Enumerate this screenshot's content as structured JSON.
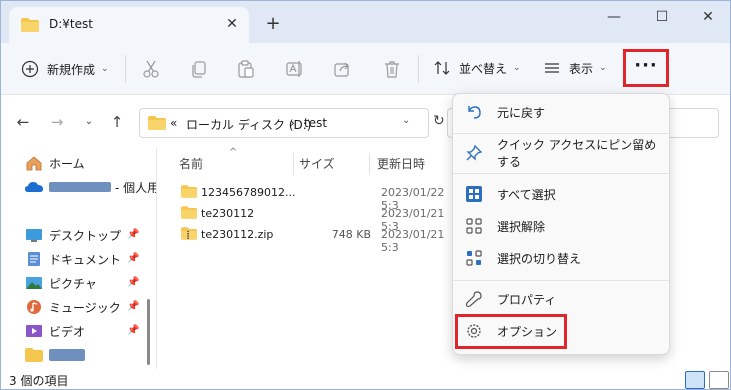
{
  "window": {
    "tab_title": "D:¥test",
    "new_tab": "+",
    "minimize": "—",
    "maximize": "☐",
    "close": "✕"
  },
  "toolbar": {
    "new_label": "新規作成",
    "sort_label": "並べ替え",
    "view_label": "表示",
    "more_label": "···",
    "caret": "⌄"
  },
  "address": {
    "overflow": "«",
    "segments": [
      "ローカル ディスク (D:)",
      "test"
    ],
    "separator": "›"
  },
  "sidebar": {
    "items": [
      {
        "label": "ホーム",
        "icon": "home-icon",
        "pinned": false
      },
      {
        "label": "- 個人用",
        "icon": "onedrive-icon",
        "pinned": false
      },
      {
        "label": "デスクトップ",
        "icon": "desktop-icon",
        "pinned": true
      },
      {
        "label": "ドキュメント",
        "icon": "documents-icon",
        "pinned": true
      },
      {
        "label": "ピクチャ",
        "icon": "pictures-icon",
        "pinned": true
      },
      {
        "label": "ミュージック",
        "icon": "music-icon",
        "pinned": true
      },
      {
        "label": "ビデオ",
        "icon": "videos-icon",
        "pinned": true
      }
    ]
  },
  "file_list": {
    "columns": [
      "名前",
      "サイズ",
      "更新日時"
    ],
    "rows": [
      {
        "name": "123456789012...",
        "size": "",
        "date": "2023/01/22 5:3",
        "type": "folder"
      },
      {
        "name": "te230112",
        "size": "",
        "date": "2023/01/21 5:3",
        "type": "folder"
      },
      {
        "name": "te230112.zip",
        "size": "748 KB",
        "date": "2023/01/21 5:3",
        "type": "zip"
      }
    ]
  },
  "menu": {
    "items": [
      {
        "label": "元に戻す",
        "icon": "undo-icon"
      },
      {
        "label": "クイック アクセスにピン留めする",
        "icon": "pin-icon"
      },
      {
        "label": "すべて選択",
        "icon": "select-all-icon"
      },
      {
        "label": "選択解除",
        "icon": "select-none-icon"
      },
      {
        "label": "選択の切り替え",
        "icon": "invert-selection-icon"
      },
      {
        "label": "プロパティ",
        "icon": "properties-icon"
      },
      {
        "label": "オプション",
        "icon": "options-icon"
      }
    ]
  },
  "status": {
    "item_count": "3 個の項目"
  },
  "colors": {
    "highlight": "#e0262b",
    "folder": "#f5c64e",
    "accent": "#2c6ec0"
  }
}
